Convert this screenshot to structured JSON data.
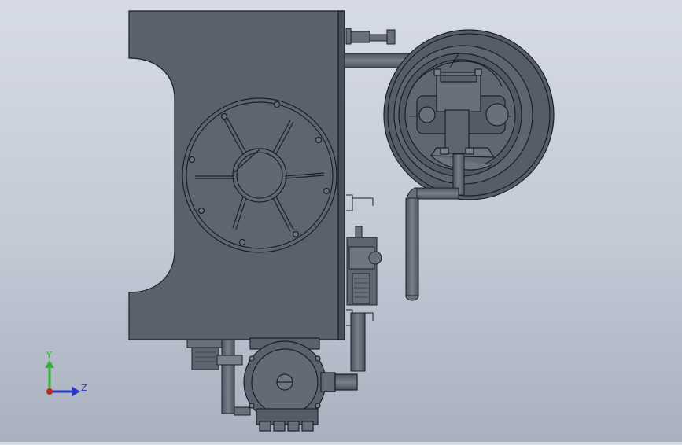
{
  "viewport": {
    "background_top": "#d6dbe4",
    "background_bottom": "#a9b0bf",
    "model_color": "#5a606c",
    "edge_color": "#1c1f26"
  },
  "triad": {
    "y_label": "Y",
    "z_label": "Z",
    "y_color": "#2fb53a",
    "z_color": "#2a35c9",
    "x_color": "#c0262b"
  }
}
